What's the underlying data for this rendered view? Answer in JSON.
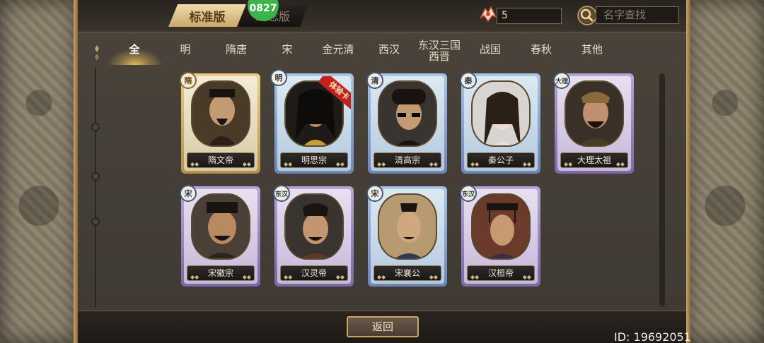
{
  "header": {
    "mode_tabs": [
      "标准版",
      "纪念版"
    ],
    "badge": "0827",
    "token_count": "5",
    "search_placeholder": "名字查找"
  },
  "filters": [
    "全",
    "明",
    "隋唐",
    "宋",
    "金元清",
    "西汉",
    "东汉三国\n西晋",
    "战国",
    "春秋",
    "其他"
  ],
  "active_filter": "全",
  "cards": [
    {
      "name": "隋文帝",
      "dynasty": "隋",
      "frame": "gold",
      "ribbon": ""
    },
    {
      "name": "明思宗",
      "dynasty": "明",
      "frame": "blue",
      "ribbon": "体验卡"
    },
    {
      "name": "清高宗",
      "dynasty": "清",
      "frame": "blue",
      "ribbon": ""
    },
    {
      "name": "秦公子",
      "dynasty": "秦",
      "frame": "blue",
      "ribbon": ""
    },
    {
      "name": "大理太祖",
      "dynasty": "大理",
      "frame": "purple",
      "ribbon": ""
    },
    {
      "name": "宋徽宗",
      "dynasty": "宋",
      "frame": "blue",
      "ribbon": ""
    },
    {
      "name": "汉灵帝",
      "dynasty": "东汉",
      "frame": "purple",
      "ribbon": ""
    },
    {
      "name": "宋襄公",
      "dynasty": "宋",
      "frame": "blue",
      "ribbon": ""
    },
    {
      "name": "汉桓帝",
      "dynasty": "东汉",
      "frame": "purple",
      "ribbon": ""
    }
  ],
  "footer": {
    "back_label": "返回",
    "id_label": "ID: 19692051"
  },
  "colors": {
    "gold_frame": "#c9a46a",
    "ribbon_red": "#c4201c",
    "badge_green": "#3db44a"
  }
}
